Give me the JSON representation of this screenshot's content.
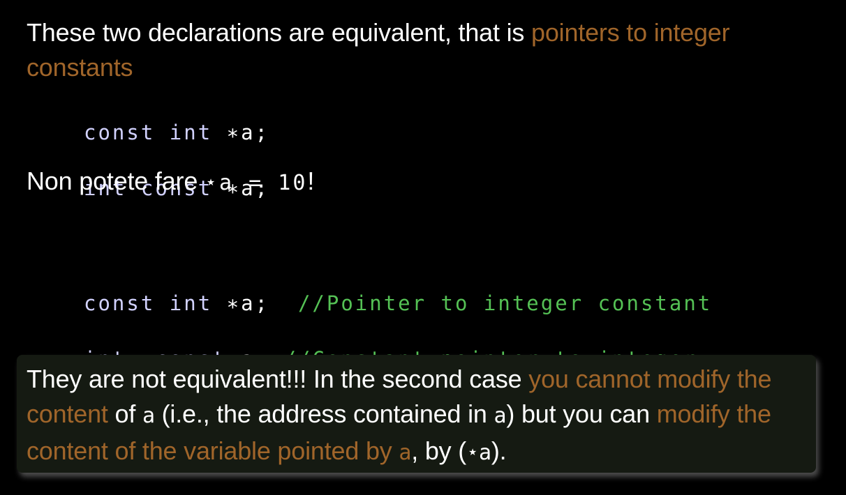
{
  "intro": {
    "text": "These two declarations are equivalent, that is ",
    "highlight": "pointers to integer constants"
  },
  "code1": {
    "line1": {
      "kw1": "const",
      "sp1": " ",
      "kw2": "int",
      "rest": " ∗a;"
    },
    "line2": {
      "kw1": "int",
      "sp1": " ",
      "kw2": "const",
      "rest": " ∗a;"
    }
  },
  "note": {
    "text": "Non potete fare ",
    "code": "⋆a = 10",
    "end": "!"
  },
  "code2": {
    "line1": {
      "kw1": "const",
      "sp1": " ",
      "kw2": "int",
      "rest": " ∗a;  ",
      "comment": "//Pointer to integer constant"
    },
    "line2": {
      "kw1": "int",
      "rest1": " ∗",
      "kw2": "const",
      "rest2": " a; ",
      "comment": "//Constant pointer to integer"
    }
  },
  "box": {
    "t1": "They are not equivalent!!! In the second case ",
    "h1": "you cannot modify the content",
    "t2": " of ",
    "c1": "a",
    "t3": " (i.e., the address contained in ",
    "c2": "a",
    "t4": ") but you can ",
    "h2": "modify the content of the variable pointed by ",
    "c3": "a",
    "t5": ", by (",
    "c4": "⋆a",
    "t6": ")."
  },
  "colors": {
    "background": "#000000",
    "accent": "#a0652a",
    "keyword": "#d2d2ff",
    "comment": "#55c155",
    "box_bg": "#151a12"
  }
}
